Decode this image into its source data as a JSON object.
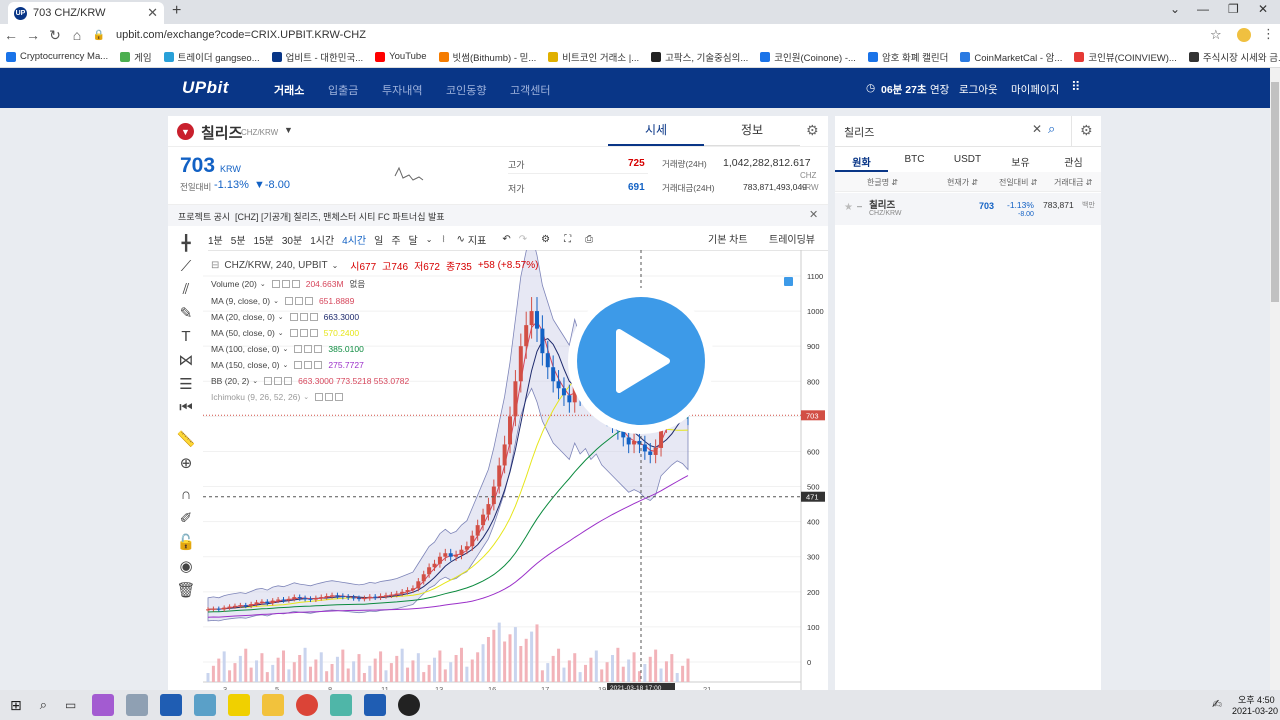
{
  "browser": {
    "tab_title": "703 CHZ/KRW",
    "url": "upbit.com/exchange?code=CRIX.UPBIT.KRW-CHZ",
    "bookmarks": [
      "Cryptocurrency Ma...",
      "게임",
      "트레이더 gangseo...",
      "업비트 - 대한민국...",
      "YouTube",
      "빗썸(Bithumb) - 믿...",
      "비트코인 거래소 |...",
      "고팍스, 기술중심의...",
      "코인원(Coinone) -...",
      "암호 화폐 캘린더",
      "CoinMarketCal - 암...",
      "코인뷰(COINVIEW)...",
      "주식시장 시세와 금..."
    ]
  },
  "header": {
    "logo": "UPbit",
    "nav": [
      "거래소",
      "입출금",
      "투자내역",
      "코인동향",
      "고객센터"
    ],
    "timer": "06분 27초",
    "extend": "연장",
    "logout": "로그아웃",
    "mypage": "마이페이지"
  },
  "coin": {
    "name": "칠리즈",
    "pair": "CHZ/KRW",
    "tab_market": "시세",
    "tab_info": "정보",
    "price": "703",
    "unit": "KRW",
    "prev_label": "전일대비",
    "change_pct": "-1.13%",
    "change_val": "▼-8.00",
    "high_label": "고가",
    "high": "725",
    "low_label": "저가",
    "low": "691",
    "vol_label": "거래량(24H)",
    "vol": "1,042,282,812.617",
    "vol_unit": "CHZ",
    "amt_label": "거래대금(24H)",
    "amt": "783,871,493,049",
    "amt_unit": "KRW"
  },
  "notice": {
    "label": "프로젝트 공시",
    "text": "[CHZ] [기공개] 칠리즈, 맨체스터 시티 FC 파트너십 발표"
  },
  "toolbar": {
    "intervals": [
      "1분",
      "5분",
      "15분",
      "30분",
      "1시간",
      "4시간",
      "일",
      "주",
      "달"
    ],
    "indicator": "지표",
    "basic": "기본 차트",
    "trading": "트레이딩뷰"
  },
  "legend": {
    "title": "CHZ/KRW, 240, UPBIT",
    "o": "시677",
    "h": "고746",
    "l": "저672",
    "c": "종735",
    "chg": "+58 (+8.57%)",
    "items": [
      {
        "label": "Volume (20)",
        "value": "204.663M",
        "extra": "없음",
        "color": "#d6475c"
      },
      {
        "label": "MA (9, close, 0)",
        "value": "651.8889",
        "color": "#d6475c"
      },
      {
        "label": "MA (20, close, 0)",
        "value": "663.3000",
        "color": "#1e2a6d"
      },
      {
        "label": "MA (50, close, 0)",
        "value": "570.2400",
        "color": "#e6e61a"
      },
      {
        "label": "MA (100, close, 0)",
        "value": "385.0100",
        "color": "#0b8a3e"
      },
      {
        "label": "MA (150, close, 0)",
        "value": "275.7727",
        "color": "#9b30c9"
      },
      {
        "label": "BB (20, 2)",
        "value": "663.3000  773.5218  553.0782",
        "color": "#d6475c"
      },
      {
        "label": "Ichimoku (9, 26, 52, 26)",
        "value": "",
        "color": "#999999"
      }
    ]
  },
  "yaxis": [
    "1100",
    "1000",
    "900",
    "800",
    "700",
    "600",
    "500",
    "400",
    "300",
    "200",
    "100",
    "0"
  ],
  "price_tag": "703",
  "cross_tag": "471",
  "time_tag": "2021-03-18   17:00",
  "xaxis": [
    "3",
    "5",
    "8",
    "11",
    "13",
    "16",
    "17",
    "19",
    "21"
  ],
  "market": {
    "search": "칠리즈",
    "tabs": [
      "원화",
      "BTC",
      "USDT",
      "보유",
      "관심"
    ],
    "cols": [
      "한글명 ⇵",
      "현재가 ⇵",
      "전일대비 ⇵",
      "거래대금 ⇵"
    ],
    "rows": [
      {
        "name": "칠리즈",
        "pair": "CHZ/KRW",
        "price": "703",
        "pct": "-1.13%",
        "chg": "-8.00",
        "amt": "783,871",
        "unit": "백만"
      }
    ]
  },
  "taskbar": {
    "time": "오후 4:50",
    "date": "2021-03-20"
  }
}
